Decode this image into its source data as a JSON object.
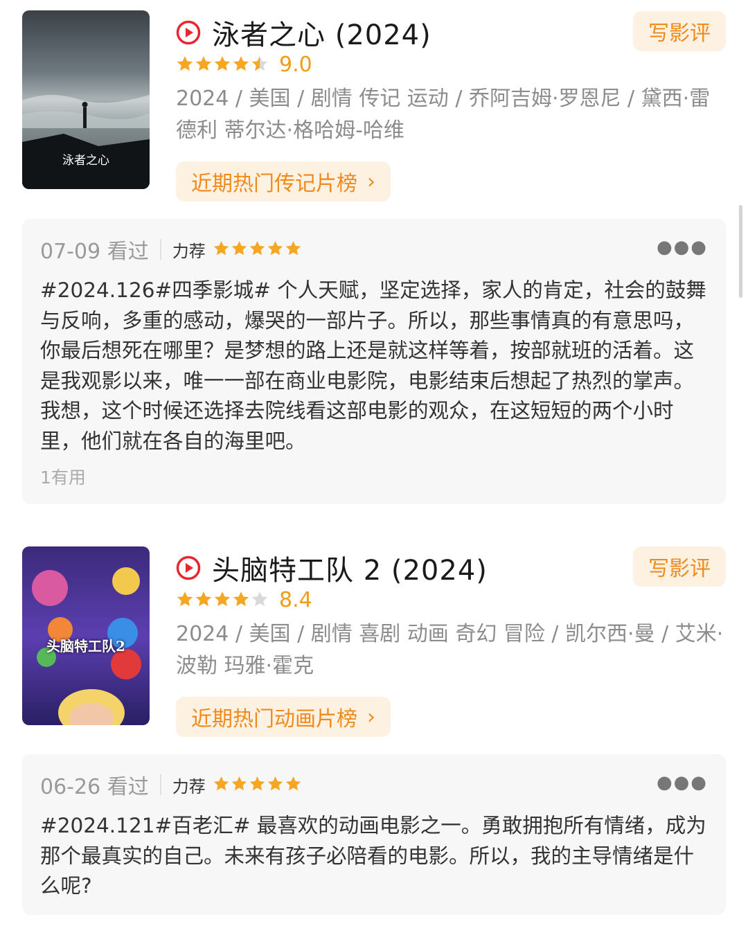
{
  "colors": {
    "accent": "#f08a1c",
    "accent_bg": "#fdf1e2",
    "star": "#f5a623",
    "play": "#e8262d"
  },
  "movies": [
    {
      "title": "泳者之心 (2024)",
      "rating_stars": 4.5,
      "score": "9.0",
      "meta": "2024 / 美国 / 剧情 传记 运动 / 乔阿吉姆·罗恩尼 / 黛西·雷德利 蒂尔达·格哈姆-哈维",
      "write_review_label": "写影评",
      "rank_label": "近期热门传记片榜",
      "poster_caption": "泳者之心",
      "review": {
        "date": "07-09 看过",
        "recommend_label": "力荐",
        "rating_stars": 5,
        "text": "#2024.126#四季影城# 个人天赋，坚定选择，家人的肯定，社会的鼓舞与反响，多重的感动，爆哭的一部片子。所以，那些事情真的有意思吗，你最后想死在哪里？是梦想的路上还是就这样等着，按部就班的活着。这是我观影以来，唯一一部在商业电影院，电影结束后想起了热烈的掌声。我想，这个时候还选择去院线看这部电影的观众，在这短短的两个小时里，他们就在各自的海里吧。",
        "useful": "1有用"
      }
    },
    {
      "title": "头脑特工队 2 (2024)",
      "rating_stars": 4,
      "score": "8.4",
      "meta": "2024 / 美国 / 剧情 喜剧 动画 奇幻 冒险 / 凯尔西·曼 / 艾米·波勒 玛雅·霍克",
      "write_review_label": "写影评",
      "rank_label": "近期热门动画片榜",
      "poster_caption": "头脑特工队2",
      "review": {
        "date": "06-26 看过",
        "recommend_label": "力荐",
        "rating_stars": 5,
        "text": "#2024.121#百老汇# 最喜欢的动画电影之一。勇敢拥抱所有情绪，成为那个最真实的自己。未来有孩子必陪看的电影。所以，我的主导情绪是什么呢?"
      }
    }
  ]
}
